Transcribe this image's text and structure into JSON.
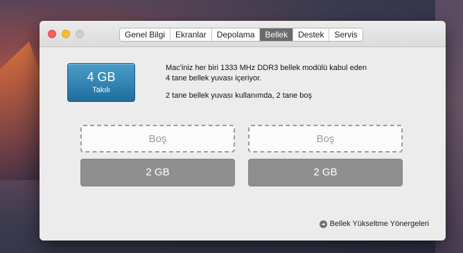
{
  "window": {
    "tabs": [
      {
        "label": "Genel Bilgi",
        "active": false
      },
      {
        "label": "Ekranlar",
        "active": false
      },
      {
        "label": "Depolama",
        "active": false
      },
      {
        "label": "Bellek",
        "active": true
      },
      {
        "label": "Destek",
        "active": false
      },
      {
        "label": "Servis",
        "active": false
      }
    ]
  },
  "memory": {
    "installed_size": "4 GB",
    "installed_label": "Takılı",
    "description_line1": "Mac'iniz her biri 1333 MHz DDR3 bellek modülü kabul eden",
    "description_line2": "4 tane bellek yuvası içeriyor.",
    "slots_status": "2 tane bellek yuvası kullanımda, 2 tane boş"
  },
  "slots": [
    {
      "label": "Boş",
      "state": "empty"
    },
    {
      "label": "Boş",
      "state": "empty"
    },
    {
      "label": "2 GB",
      "state": "filled"
    },
    {
      "label": "2 GB",
      "state": "filled"
    }
  ],
  "footer": {
    "upgrade_link": "Bellek Yükseltme Yönergeleri",
    "icon": "arrow-circle-right-icon"
  },
  "colors": {
    "accent_badge": "#1f6e9e",
    "active_tab": "#6b6b6b",
    "filled_slot": "#8f8f8f"
  }
}
